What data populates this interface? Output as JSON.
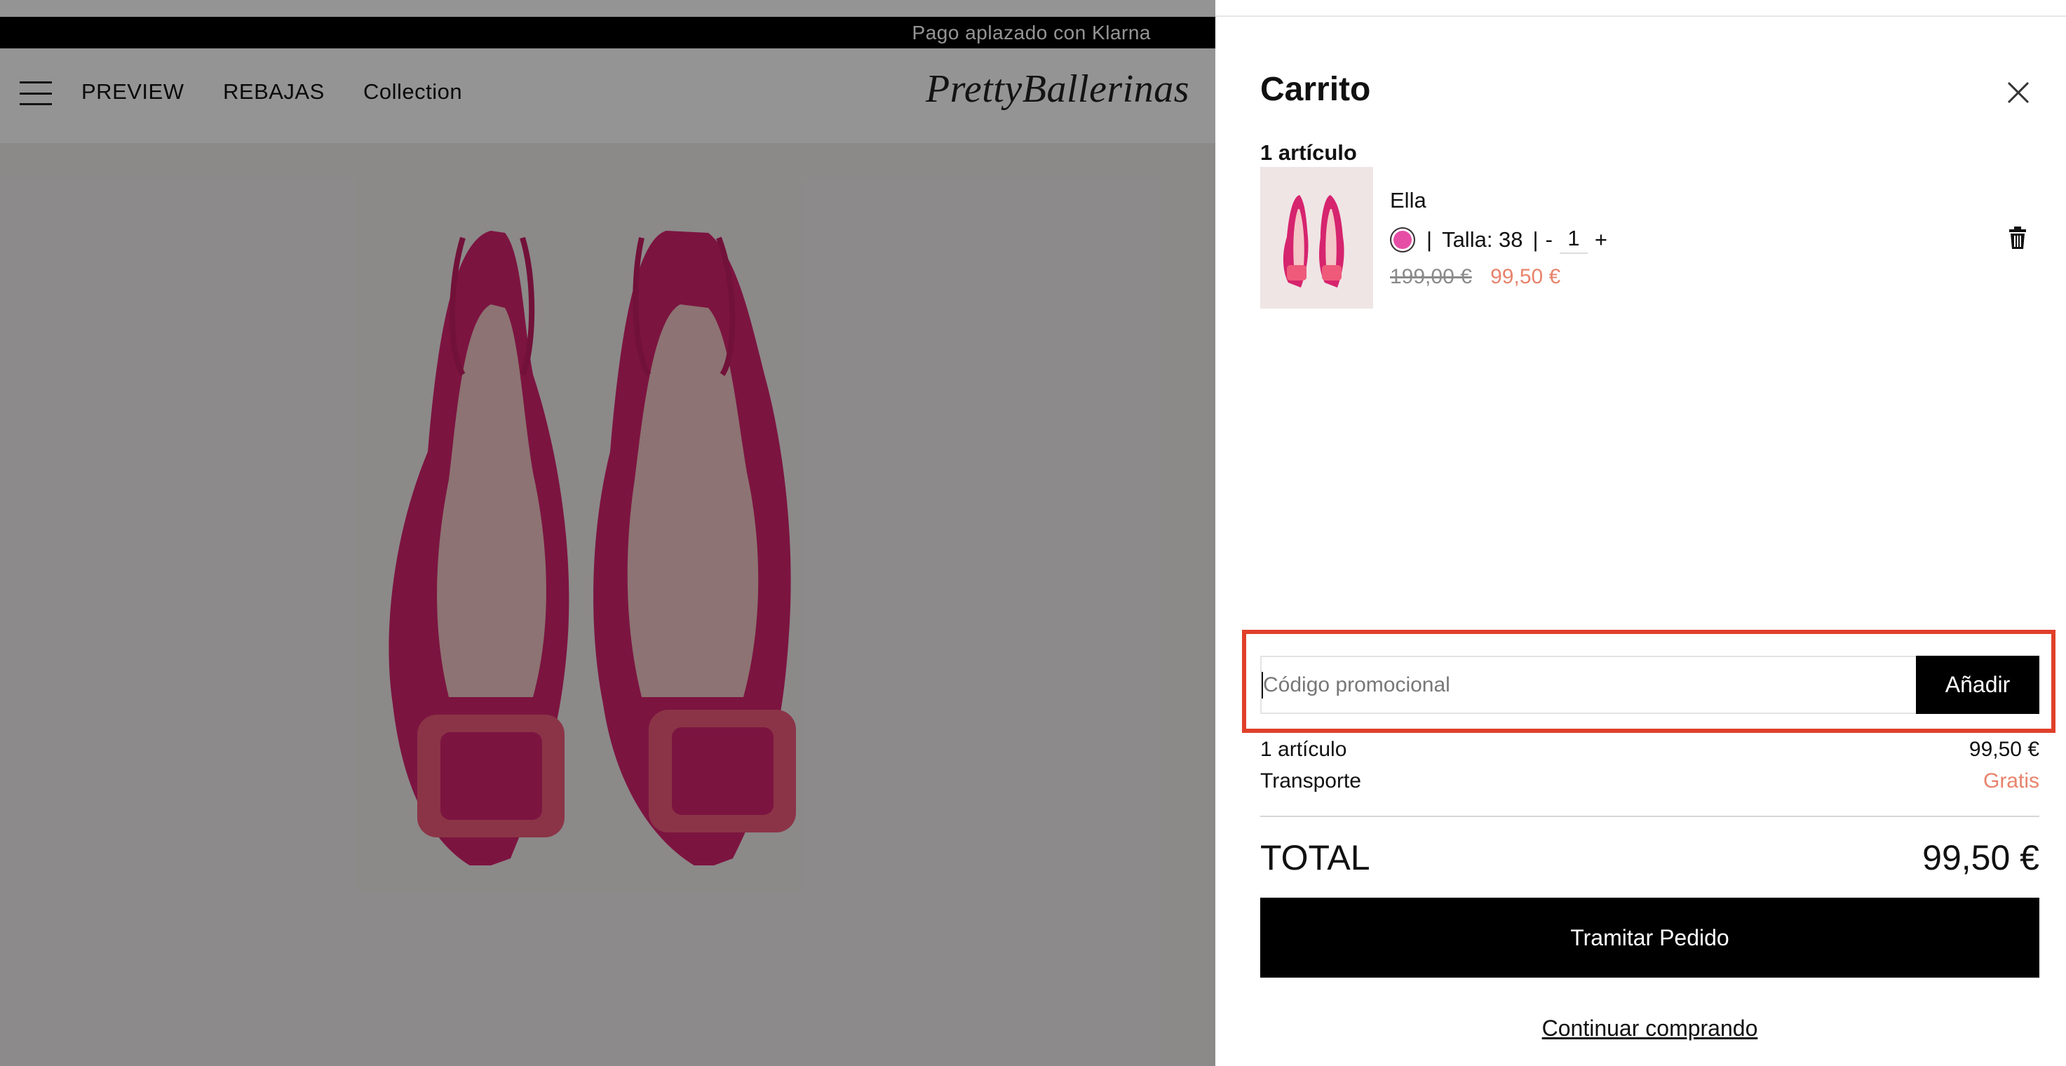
{
  "site": {
    "promo_bar": "Pago aplazado con Klarna",
    "logo": "PrettyBallerinas",
    "nav": [
      "PREVIEW",
      "REBAJAS",
      "Collection"
    ]
  },
  "cart": {
    "title": "Carrito",
    "count_label": "1 artículo",
    "item": {
      "name": "Ella",
      "size_label": "Talla: 38",
      "qty_minus": "-",
      "quantity": "1",
      "qty_plus": "+",
      "price_old": "199,00 €",
      "price_new": "99,50 €",
      "swatch_color": "#e64ea6"
    },
    "promo": {
      "placeholder": "Código promocional",
      "button": "Añadir"
    },
    "summary": {
      "items_label": "1 artículo",
      "items_value": "99,50 €",
      "shipping_label": "Transporte",
      "shipping_value": "Gratis"
    },
    "total_label": "TOTAL",
    "total_value": "99,50 €",
    "checkout_button": "Tramitar Pedido",
    "continue_link": "Continuar comprando"
  },
  "colors": {
    "accent_sale": "#e8836c",
    "highlight": "#e0402a",
    "shoe": "#d6246e"
  }
}
